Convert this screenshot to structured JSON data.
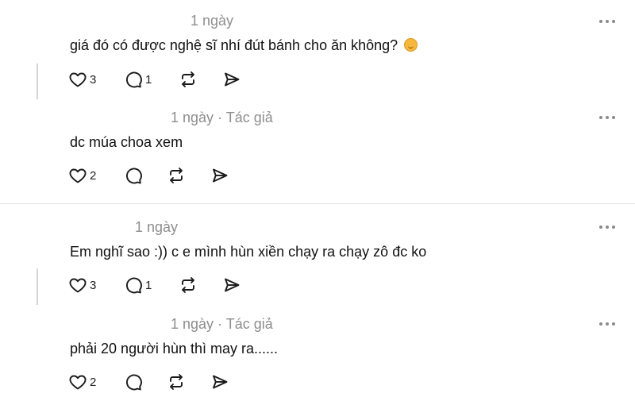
{
  "comments": [
    {
      "meta": "1 ngày",
      "text": "giá đó có được nghệ sĩ nhí đút bánh cho ăn không?",
      "emoji": "upside-down-face",
      "likes": "3",
      "replies": "1"
    },
    {
      "meta": "1 ngày · Tác giả",
      "text": "dc múa choa xem",
      "likes": "2"
    },
    {
      "meta": "1 ngày",
      "text": "Em nghĩ sao :)) c e mình hùn xiền chạy ra chạy zô đc ko",
      "likes": "3",
      "replies": "1"
    },
    {
      "meta": "1 ngày · Tác giả",
      "text": "phải 20 người hùn thì may ra......",
      "likes": "2"
    }
  ],
  "icons": {
    "like": "heart-icon",
    "reply": "comment-icon",
    "repost": "repost-icon",
    "share": "send-icon",
    "more": "more-dots-icon"
  },
  "colors": {
    "text": "#111111",
    "muted": "#8e8e8e",
    "line": "#d6d6d6"
  }
}
